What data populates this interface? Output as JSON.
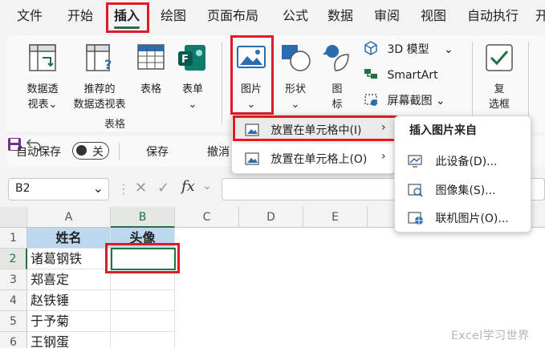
{
  "menu": {
    "tabs": [
      "文件",
      "开始",
      "插入",
      "绘图",
      "页面布局",
      "公式",
      "数据",
      "审阅",
      "视图",
      "自动执行",
      "开"
    ],
    "active_index": 2
  },
  "ribbon": {
    "pivot_label1": "数据透",
    "pivot_label2": "视表",
    "rec_pivot_label1": "推荐的",
    "rec_pivot_label2": "数据透视表",
    "table_label": "表格",
    "forms_label": "表单",
    "tables_group_label": "表格",
    "picture_label": "图片",
    "shapes_label": "形状",
    "icons_label1": "图",
    "icons_label2": "标",
    "model3d_label": "3D 模型",
    "smartart_label": "SmartArt",
    "screenshot_label": "屏幕截图",
    "checkbox_label1": "复",
    "checkbox_label2": "选框",
    "chevron": "⌄"
  },
  "qat": {
    "autosave_label": "自动保存",
    "toggle_state": "关",
    "save_label": "保存",
    "undo_label": "撤消"
  },
  "formula_bar": {
    "name_box": "B2",
    "fx": "fx"
  },
  "grid": {
    "columns": [
      "A",
      "B",
      "C",
      "D",
      "E"
    ],
    "rows": [
      "1",
      "2",
      "3",
      "4",
      "5",
      "6"
    ],
    "header_cells": [
      "姓名",
      "头像"
    ],
    "names": [
      "诸葛钢铁",
      "郑喜定",
      "赵铁锤",
      "于予菊",
      "王钢蛋"
    ],
    "selected_cell": "B2"
  },
  "picture_menu": {
    "items": [
      "放置在单元格中(I)",
      "放置在单元格上(O)"
    ]
  },
  "insert_from_menu": {
    "title": "插入图片来自",
    "items": [
      "此设备(D)...",
      "图像集(S)...",
      "联机图片(O)..."
    ]
  },
  "watermark": "Excel学习世界",
  "colors": {
    "accent_green": "#217346",
    "highlight_red": "#e01b24",
    "header_blue": "#bdd7ee"
  }
}
